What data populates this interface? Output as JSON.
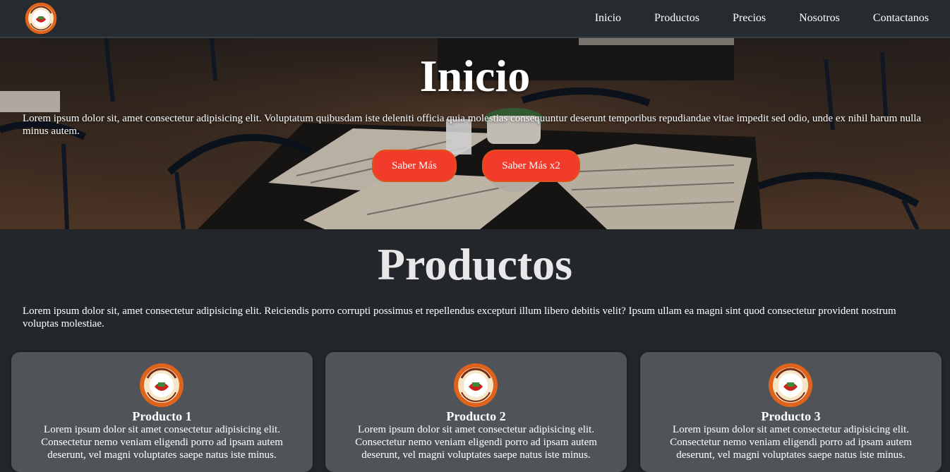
{
  "nav": {
    "logo_alt": "Balafon logo",
    "links": [
      "Inicio",
      "Productos",
      "Precios",
      "Nosotros",
      "Contactanos"
    ]
  },
  "hero": {
    "title": "Inicio",
    "text": "Lorem ipsum dolor sit, amet consectetur adipisicing elit. Voluptatum quibusdam iste deleniti officia quia molestias consequuntur deserunt temporibus repudiandae vitae impedit sed odio, unde ex nihil harum nulla minus autem.",
    "button_1": "Saber Más",
    "button_2": "Saber Más x2"
  },
  "products": {
    "title": "Productos",
    "text": "Lorem ipsum dolor sit, amet consectetur adipisicing elit. Reiciendis porro corrupti possimus et repellendus excepturi illum libero debitis velit? Ipsum ullam ea magni sint quod consectetur provident nostrum voluptas molestiae.",
    "cards": [
      {
        "title": "Producto 1",
        "text": "Lorem ipsum dolor sit amet consectetur adipisicing elit. Consectetur nemo veniam eligendi porro ad ipsam autem deserunt, vel magni voluptates saepe natus iste minus."
      },
      {
        "title": "Producto 2",
        "text": "Lorem ipsum dolor sit amet consectetur adipisicing elit. Consectetur nemo veniam eligendi porro ad ipsam autem deserunt, vel magni voluptates saepe natus iste minus."
      },
      {
        "title": "Producto 3",
        "text": "Lorem ipsum dolor sit amet consectetur adipisicing elit. Consectetur nemo veniam eligendi porro ad ipsam autem deserunt, vel magni voluptates saepe natus iste minus."
      }
    ]
  },
  "colors": {
    "background": "#23272b",
    "nav": "#262b30",
    "card": "#505458",
    "button": "#f23b2a",
    "logo_ring": "#e0631c"
  },
  "icons": {
    "logo": "balafon-logo-icon"
  }
}
